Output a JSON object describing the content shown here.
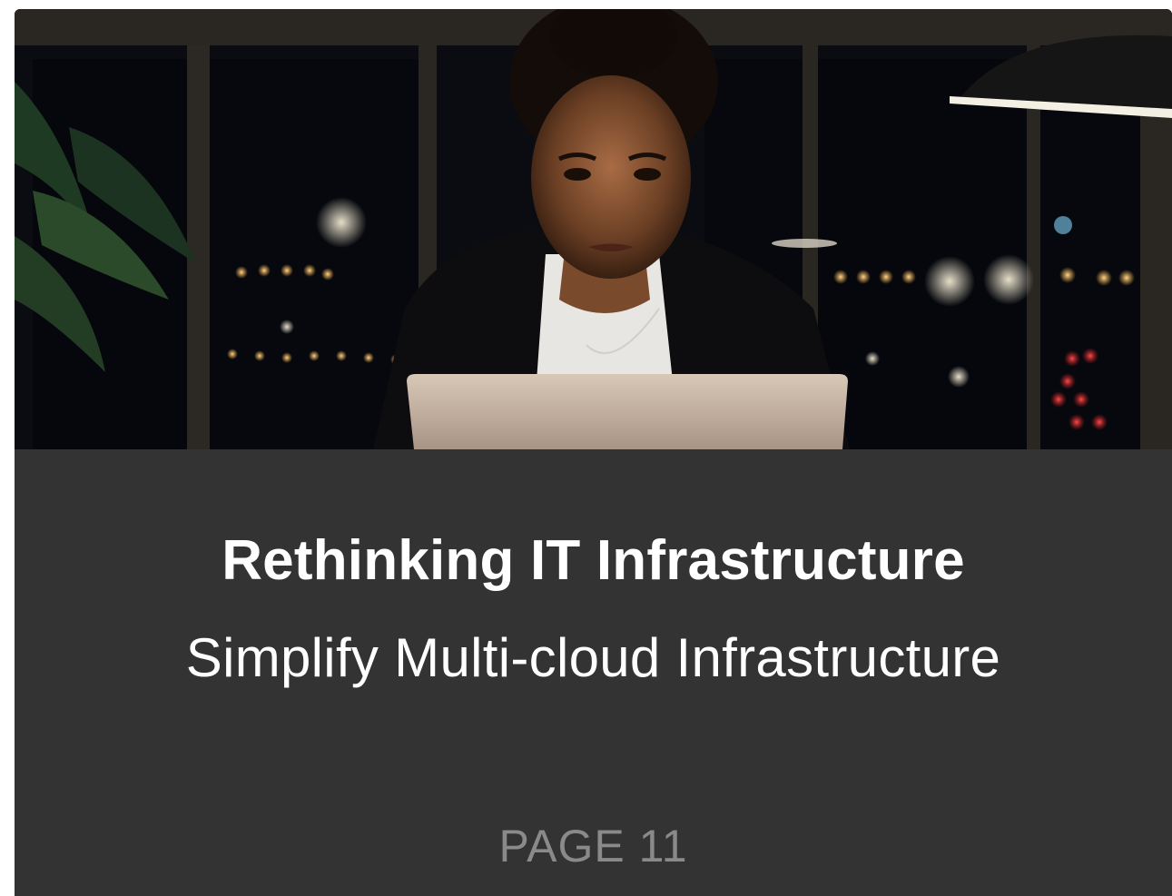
{
  "card": {
    "title": "Rethinking IT Infrastructure",
    "subtitle": "Simplify Multi-cloud Infrastructure",
    "page_label": "PAGE 11"
  },
  "hero_image": {
    "icon": "photo-woman-working-on-laptop-at-night"
  },
  "colors": {
    "card_background": "#333333",
    "title_text": "#ffffff",
    "page_text": "#8a8a8a"
  }
}
